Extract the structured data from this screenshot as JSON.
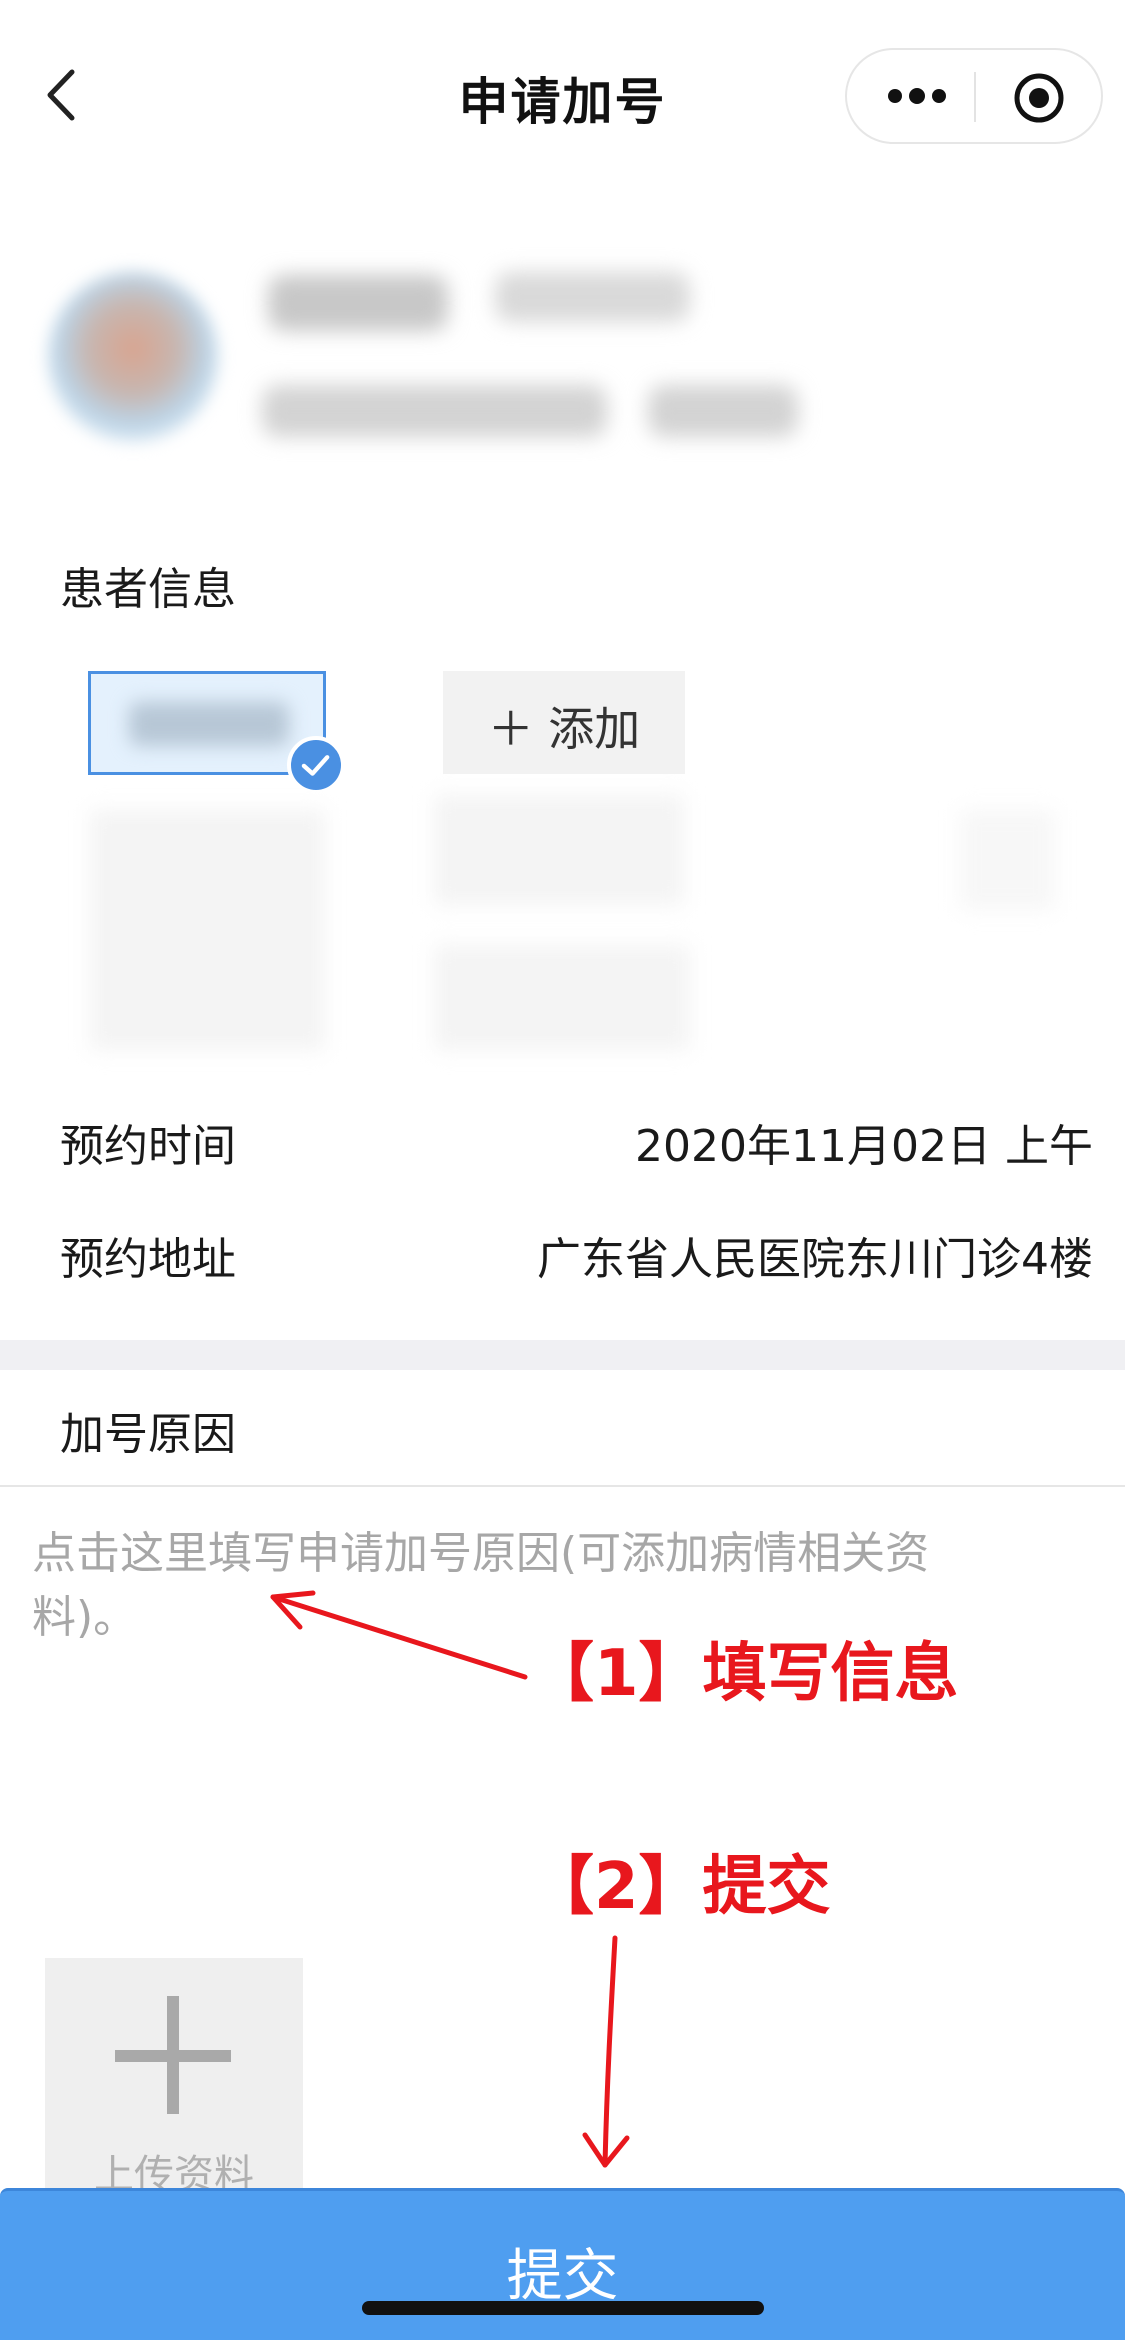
{
  "nav": {
    "title": "申请加号",
    "back_icon": "chevron-left-icon",
    "more_icon": "more-dots-icon",
    "close_icon": "target-circle-icon"
  },
  "patient_section": {
    "label": "患者信息",
    "add_label": "＋ 添加"
  },
  "appointment": {
    "time_label": "预约时间",
    "time_value": "2020年11月02日 上午",
    "address_label": "预约地址",
    "address_value": "广东省人民医院东川门诊4楼"
  },
  "reason": {
    "label": "加号原因",
    "placeholder_line1": "点击这里填写申请加号原因(可添加病情相关资",
    "placeholder_line2": "料)。"
  },
  "annotations": {
    "step1": "【1】填写信息",
    "step2": "【2】提交",
    "color": "#e8171d"
  },
  "upload": {
    "label": "上传资料"
  },
  "submit": {
    "label": "提交",
    "color": "#4f9ef0"
  }
}
